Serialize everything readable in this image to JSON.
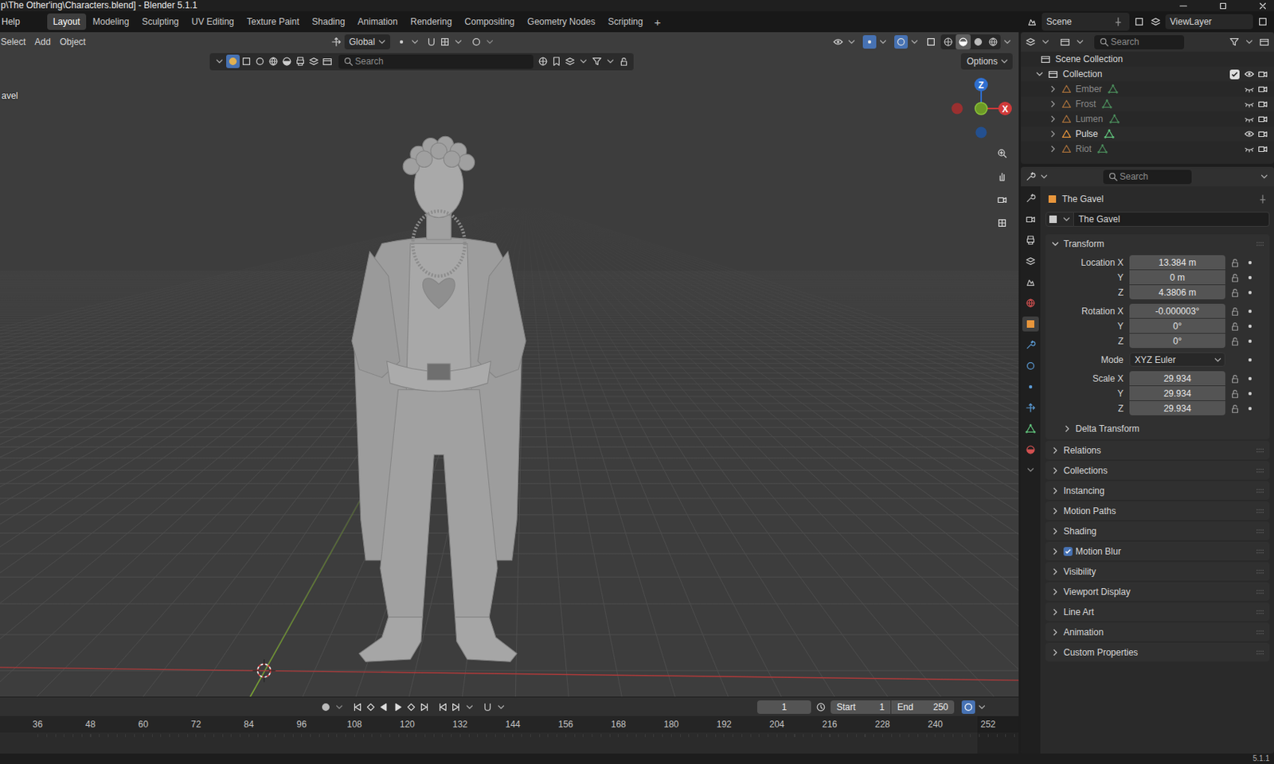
{
  "window": {
    "title": "p\\The Other'ing\\Characters.blend] - Blender 5.1.1"
  },
  "menu": [
    "Help"
  ],
  "workspaces": [
    {
      "label": "Layout",
      "selected": true
    },
    {
      "label": "Modeling",
      "selected": false
    },
    {
      "label": "Sculpting",
      "selected": false
    },
    {
      "label": "UV Editing",
      "selected": false
    },
    {
      "label": "Texture Paint",
      "selected": false
    },
    {
      "label": "Shading",
      "selected": false
    },
    {
      "label": "Animation",
      "selected": false
    },
    {
      "label": "Rendering",
      "selected": false
    },
    {
      "label": "Compositing",
      "selected": false
    },
    {
      "label": "Geometry Nodes",
      "selected": false
    },
    {
      "label": "Scripting",
      "selected": false
    }
  ],
  "add_workspace": "+",
  "scene": "Scene",
  "view_layer": "ViewLayer",
  "viewport": {
    "menus": [
      "Select",
      "Add",
      "Object"
    ],
    "orientation": "Global",
    "toggles": [
      {
        "on": true
      },
      {
        "on": true
      },
      {
        "on": false
      }
    ],
    "shading": [
      {
        "selected": false
      },
      {
        "selected": true
      },
      {
        "selected": false
      },
      {
        "selected": false
      }
    ],
    "tool_icons": [
      {
        "selected": true
      },
      {
        "selected": false
      },
      {
        "selected": false
      },
      {
        "selected": false
      },
      {
        "selected": false
      },
      {
        "selected": false
      },
      {
        "selected": false
      },
      {
        "selected": false
      }
    ],
    "search": {
      "placeholder": "Search"
    },
    "options": "Options",
    "object_label": "avel",
    "gizmo": {
      "z": "Z",
      "x": "X"
    }
  },
  "timeline": {
    "frame": "1",
    "start_label": "Start",
    "start": "1",
    "end_label": "End",
    "end": "250",
    "ruler": [
      "36",
      "48",
      "60",
      "72",
      "84",
      "96",
      "108",
      "120",
      "132",
      "144",
      "156",
      "168",
      "180",
      "192",
      "204",
      "216",
      "228",
      "240",
      "252"
    ]
  },
  "outliner": {
    "search": {
      "placeholder": "Search"
    },
    "scene_collection": "Scene Collection",
    "collection": {
      "label": "Collection",
      "checked": true
    },
    "items": [
      {
        "name": "Ember",
        "visible": false
      },
      {
        "name": "Frost",
        "visible": false
      },
      {
        "name": "Lumen",
        "visible": false
      },
      {
        "name": "Pulse",
        "visible": true
      },
      {
        "name": "Riot",
        "visible": false
      }
    ]
  },
  "properties": {
    "search": {
      "placeholder": "Search"
    },
    "tabs": [
      {
        "selected": false
      },
      {
        "selected": false
      },
      {
        "selected": false
      },
      {
        "selected": false
      },
      {
        "selected": false
      },
      {
        "selected": false
      },
      {
        "selected": true
      },
      {
        "selected": false
      },
      {
        "selected": false
      },
      {
        "selected": false
      },
      {
        "selected": false
      },
      {
        "selected": false
      },
      {
        "selected": false
      }
    ],
    "object_name": "The Gavel",
    "name_field": "The Gavel",
    "transform": {
      "title": "Transform",
      "expanded": true,
      "groups": [
        {
          "rows": [
            {
              "kind": "number",
              "label": "Location X",
              "value": "13.384 m"
            },
            {
              "kind": "number",
              "label": "Y",
              "value": "0 m"
            },
            {
              "kind": "number",
              "label": "Z",
              "value": "4.3806 m"
            }
          ]
        },
        {
          "rows": [
            {
              "kind": "number",
              "label": "Rotation X",
              "value": "-0.000003°"
            },
            {
              "kind": "number",
              "label": "Y",
              "value": "0°"
            },
            {
              "kind": "number",
              "label": "Z",
              "value": "0°"
            }
          ]
        },
        {
          "rows": [
            {
              "kind": "dropdown",
              "label": "Mode",
              "value": "XYZ Euler"
            }
          ]
        },
        {
          "rows": [
            {
              "kind": "number",
              "label": "Scale X",
              "value": "29.934"
            },
            {
              "kind": "number",
              "label": "Y",
              "value": "29.934"
            },
            {
              "kind": "number",
              "label": "Z",
              "value": "29.934"
            }
          ]
        }
      ],
      "delta": {
        "label": "Delta Transform",
        "expanded": false
      }
    },
    "panels": [
      {
        "kind": "plain",
        "label": "Relations",
        "expanded": false
      },
      {
        "kind": "plain",
        "label": "Collections",
        "expanded": false
      },
      {
        "kind": "plain",
        "label": "Instancing",
        "expanded": false
      },
      {
        "kind": "plain",
        "label": "Motion Paths",
        "expanded": false
      },
      {
        "kind": "plain",
        "label": "Shading",
        "expanded": false
      },
      {
        "kind": "checkbox",
        "label": "Motion Blur",
        "expanded": false,
        "checked": true
      },
      {
        "kind": "plain",
        "label": "Visibility",
        "expanded": false
      },
      {
        "kind": "plain",
        "label": "Viewport Display",
        "expanded": false
      },
      {
        "kind": "plain",
        "label": "Line Art",
        "expanded": false
      },
      {
        "kind": "plain",
        "label": "Animation",
        "expanded": false
      },
      {
        "kind": "plain",
        "label": "Custom Properties",
        "expanded": false
      }
    ]
  },
  "status_bar": {
    "version": "5.1.1"
  }
}
